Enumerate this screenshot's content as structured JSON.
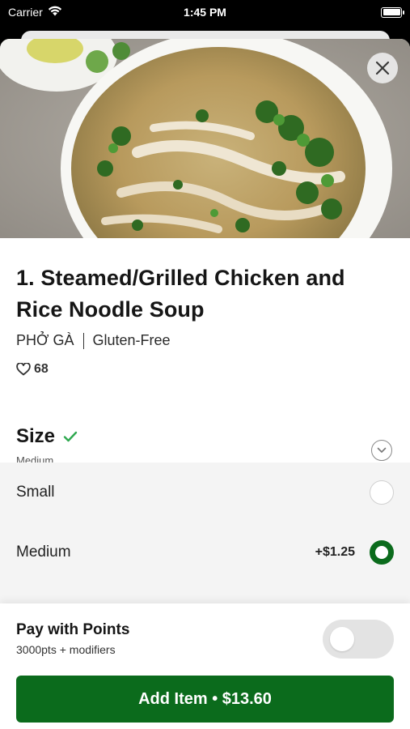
{
  "status_bar": {
    "carrier": "Carrier",
    "time": "1:45 PM"
  },
  "item": {
    "title": "1. Steamed/Grilled Chicken and Rice Noodle Soup",
    "name_vi": "PHỞ GÀ",
    "tag": "Gluten-Free",
    "likes": "68"
  },
  "size": {
    "title": "Size",
    "selected": "Medium",
    "options": [
      {
        "label": "Small",
        "price": "",
        "selected": false
      },
      {
        "label": "Medium",
        "price": "+$1.25",
        "selected": true
      }
    ]
  },
  "points": {
    "label": "Pay with Points",
    "sub": "3000pts + modifiers",
    "enabled": false
  },
  "cta": {
    "label": "Add Item • $13.60"
  },
  "colors": {
    "brand_green": "#0b6b1c",
    "check_green": "#2ea84f"
  },
  "icons": [
    "wifi-icon",
    "battery-icon",
    "close-icon",
    "heart-icon",
    "check-icon",
    "chevron-down-icon"
  ]
}
